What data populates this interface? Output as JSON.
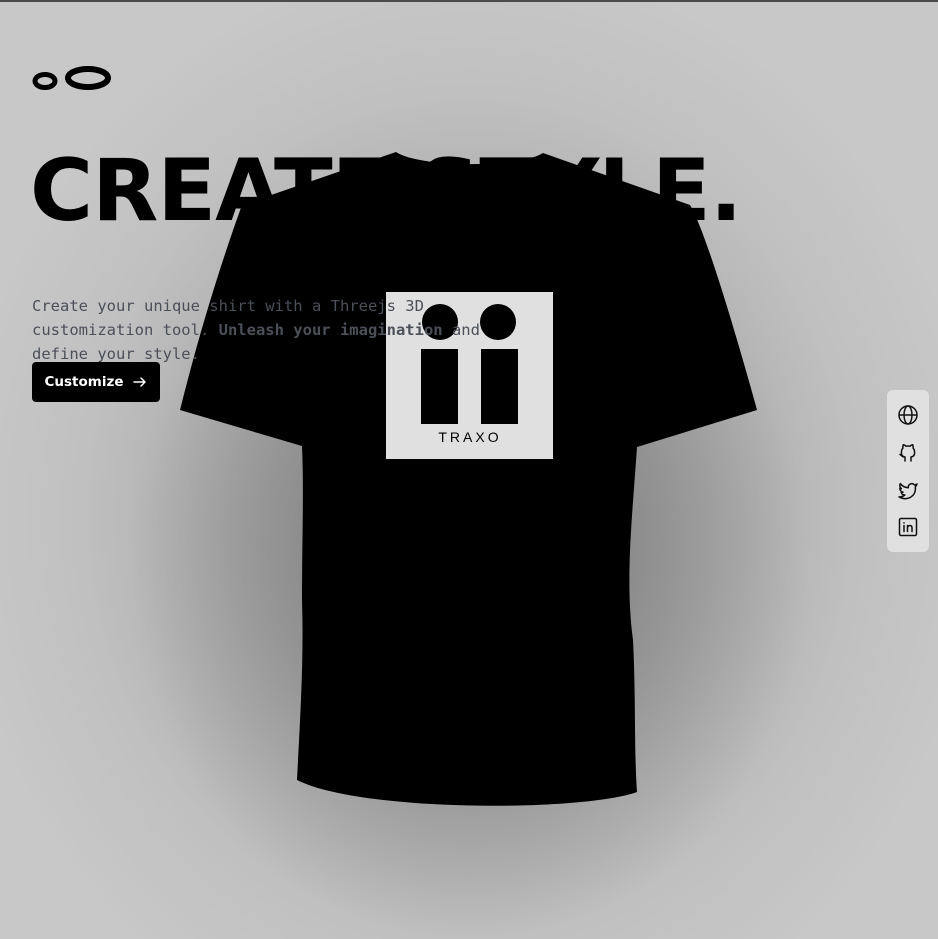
{
  "hero": {
    "headline": "CREATE STYLE.",
    "subtitle_part1": "Create your unique shirt with a Threejs 3D customization tool. ",
    "subtitle_bold": "Unleash your imagination",
    "subtitle_part2": " and define your style.",
    "cta_label": "Customize",
    "cta_icon": "arrow-right-icon"
  },
  "shirt": {
    "color": "#000000",
    "decal_text": "TRAXO",
    "decal_background": "#e0e0e0"
  },
  "social_links": [
    {
      "icon": "globe-icon",
      "label": "Website"
    },
    {
      "icon": "github-icon",
      "label": "GitHub"
    },
    {
      "icon": "twitter-icon",
      "label": "Twitter"
    },
    {
      "icon": "linkedin-icon",
      "label": "LinkedIn"
    }
  ],
  "colors": {
    "background": "#c2c2c2",
    "text_primary": "#000000",
    "text_muted": "#4b4f58",
    "button_bg": "#000000",
    "button_text": "#ffffff",
    "panel_bg": "#e0e0e0"
  }
}
